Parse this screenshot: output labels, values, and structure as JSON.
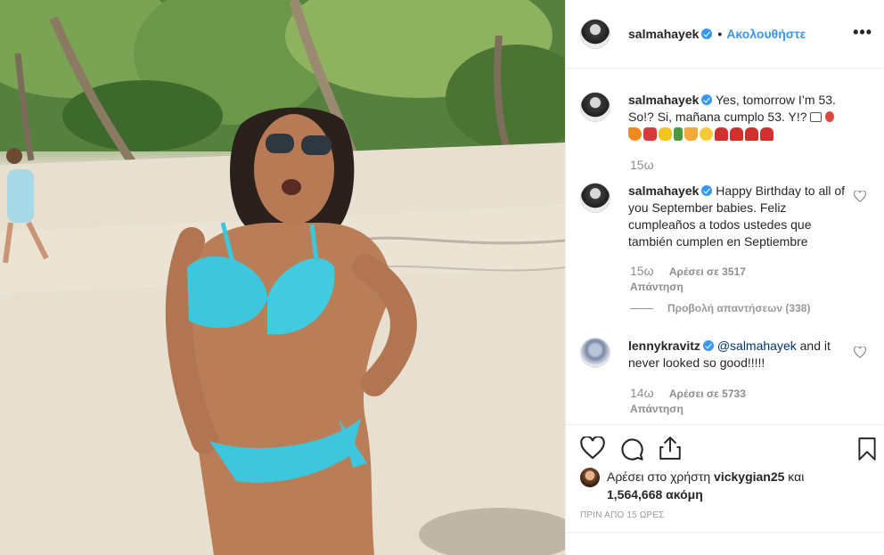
{
  "header": {
    "username": "salmahayek",
    "follow_label": "Ακολουθήστε",
    "more_label": "•••"
  },
  "caption": {
    "username": "salmahayek",
    "text": "Yes, tomorrow I’m 53. So!? Si, mañana cumplo 53. Y!?",
    "time": "15ω",
    "emojis": [
      "cake-icon",
      "balloon-icon",
      "carrot-icon",
      "bikini-icon",
      "corn-icon",
      "bottle-icon",
      "drink-icon",
      "sunglasses-face-icon",
      "dancer-icon",
      "dancer-icon",
      "dancer-icon",
      "dancer-icon"
    ]
  },
  "comments": [
    {
      "username": "salmahayek",
      "text": "Happy Birthday to all of you September babies. Feliz cumpleaños a todos ustedes que también cumplen en Septiembre",
      "time": "15ω",
      "likes": "Αρέσει σε 3517",
      "reply_label": "Απάντηση",
      "view_replies": "Προβολή απαντήσεων (338)"
    },
    {
      "username": "lennykravitz",
      "mention": "@salmahayek",
      "text": " and it never looked so good!!!!!",
      "time": "14ω",
      "likes": "Αρέσει σε 5733",
      "reply_label": "Απάντηση"
    }
  ],
  "likes_summary": {
    "prefix": "Αρέσει στο χρήστη ",
    "user": "vickygian25",
    "middle": " και",
    "count": "1,564,668 ακόμη"
  },
  "posted_ago": "ΠΡΙΝ ΑΠΟ 15 ΩΡΕΣ",
  "colors": {
    "accent": "#3897f0",
    "verified": "#3897f0",
    "bikini": "#3ec6dc",
    "text": "#262626",
    "muted": "#8e8e8e"
  }
}
